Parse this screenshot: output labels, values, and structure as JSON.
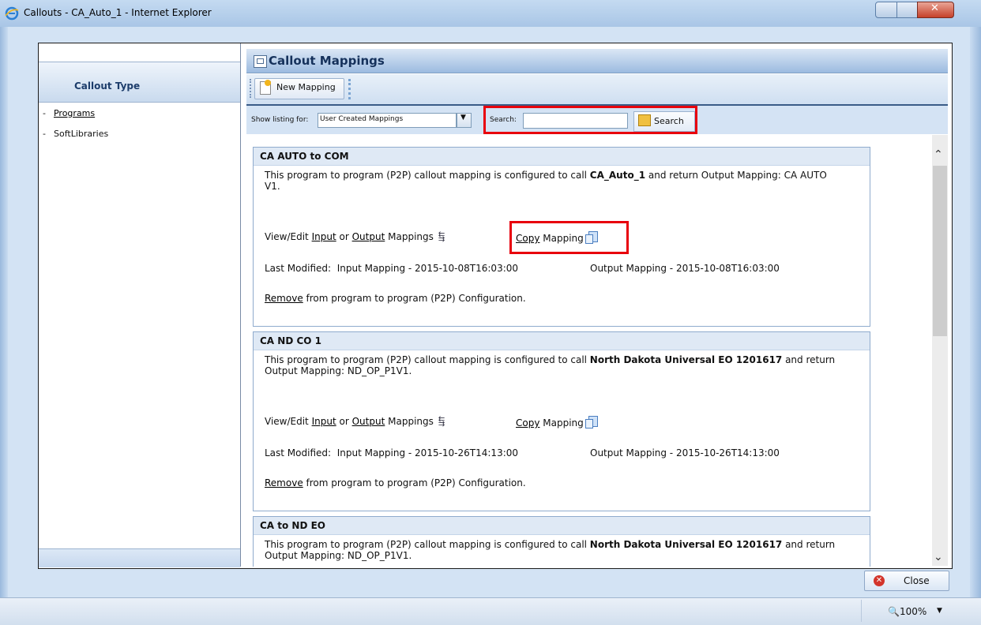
{
  "window": {
    "title": "Callouts - CA_Auto_1 - Internet Explorer"
  },
  "left_panel": {
    "header": "Callout Type",
    "items": [
      {
        "label": "Programs",
        "link": true
      },
      {
        "label": "SoftLibraries",
        "link": false
      }
    ]
  },
  "panel": {
    "title": "Callout Mappings",
    "toolbar": {
      "new_mapping_label": "New Mapping"
    },
    "filter": {
      "show_listing_label": "Show listing for:",
      "listing_value": "User Created Mappings",
      "search_label": "Search:",
      "search_value": "",
      "search_button": "Search"
    }
  },
  "common": {
    "view_edit": "View/Edit",
    "input": "Input",
    "or": "or",
    "output": "Output",
    "mappings": "Mappings",
    "copy": "Copy",
    "mapping": "Mapping",
    "last_modified": "Last Modified:",
    "remove": "Remove",
    "remove_rest": "from program to program (P2P) Configuration."
  },
  "cards": [
    {
      "title": "CA AUTO to COM",
      "desc_pre": "This program to program (P2P) callout mapping is configured to call ",
      "desc_bold": "CA_Auto_1",
      "desc_post": " and return Output Mapping: CA AUTO V1.",
      "input_modified": "Input Mapping - 2015-10-08T16:03:00",
      "output_modified": "Output Mapping - 2015-10-08T16:03:00"
    },
    {
      "title": "CA ND CO 1",
      "desc_pre": "This program to program (P2P) callout mapping is configured to call ",
      "desc_bold": "North Dakota Universal EO 1201617",
      "desc_post": " and return Output Mapping: ND_OP_P1V1.",
      "input_modified": "Input Mapping - 2015-10-26T14:13:00",
      "output_modified": "Output Mapping - 2015-10-26T14:13:00"
    },
    {
      "title": "CA to ND EO",
      "desc_pre": "This program to program (P2P) callout mapping is configured to call ",
      "desc_bold": "North Dakota Universal EO 1201617",
      "desc_post": " and return Output Mapping: ND_OP_P1V1."
    }
  ],
  "footer": {
    "close_label": "Close"
  },
  "statusbar": {
    "zoom": "100%"
  },
  "colors": {
    "highlight": "#e8000c",
    "accent": "#15315b"
  }
}
